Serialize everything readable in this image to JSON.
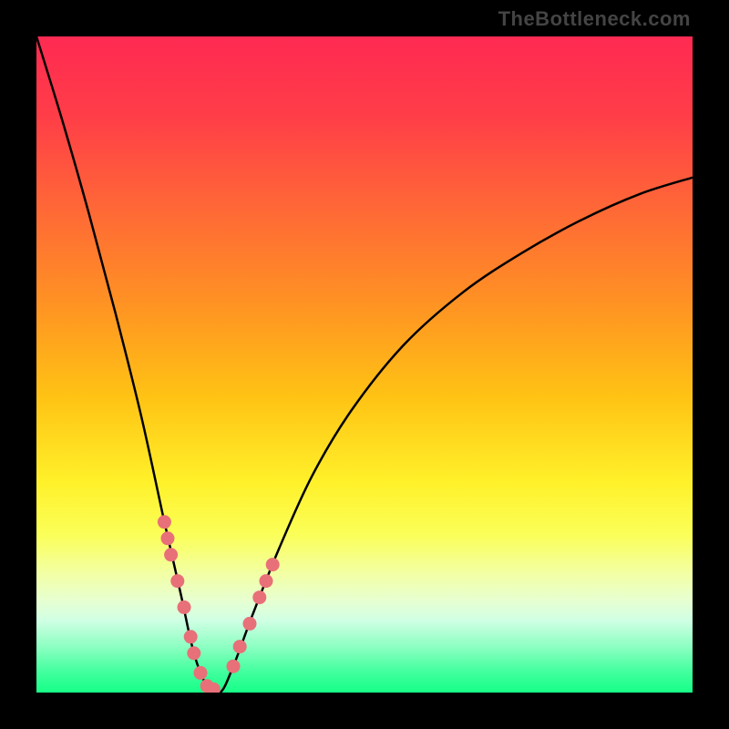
{
  "watermark": "TheBottleneck.com",
  "gradient_stops": [
    {
      "pct": 0,
      "color": "#ff2a52"
    },
    {
      "pct": 12,
      "color": "#ff3d48"
    },
    {
      "pct": 25,
      "color": "#ff6438"
    },
    {
      "pct": 40,
      "color": "#ff9024"
    },
    {
      "pct": 55,
      "color": "#ffc314"
    },
    {
      "pct": 68,
      "color": "#fff12a"
    },
    {
      "pct": 76,
      "color": "#fbff59"
    },
    {
      "pct": 82,
      "color": "#f2ffa6"
    },
    {
      "pct": 86,
      "color": "#e7ffd1"
    },
    {
      "pct": 89,
      "color": "#d0ffe4"
    },
    {
      "pct": 93,
      "color": "#8cffc2"
    },
    {
      "pct": 97,
      "color": "#3fff9d"
    },
    {
      "pct": 100,
      "color": "#17ff88"
    }
  ],
  "chart_data": {
    "type": "line",
    "title": "",
    "xlabel": "",
    "ylabel": "",
    "x_unit": "fraction of width (0=left,1=right)",
    "y_unit": "bottleneck % (0=perfect match at bottom, 100=top)",
    "xlim": [
      0,
      1
    ],
    "ylim": [
      0,
      100
    ],
    "series": [
      {
        "name": "bottleneck-curve",
        "x": [
          0.0,
          0.04,
          0.08,
          0.12,
          0.16,
          0.195,
          0.22,
          0.24,
          0.26,
          0.28,
          0.3,
          0.33,
          0.37,
          0.42,
          0.48,
          0.56,
          0.65,
          0.74,
          0.83,
          0.92,
          1.0
        ],
        "y": [
          100.0,
          87.0,
          73.0,
          58.0,
          42.0,
          26.0,
          15.0,
          6.0,
          1.0,
          0.0,
          4.0,
          12.0,
          22.0,
          33.0,
          43.0,
          53.0,
          61.0,
          67.0,
          72.0,
          76.0,
          78.5
        ]
      },
      {
        "name": "highlighted-points-left",
        "x": [
          0.195,
          0.2,
          0.205,
          0.215,
          0.225,
          0.235,
          0.24,
          0.25,
          0.26,
          0.27
        ],
        "y": [
          26.0,
          23.5,
          21.0,
          17.0,
          13.0,
          8.5,
          6.0,
          3.0,
          1.0,
          0.5
        ]
      },
      {
        "name": "highlighted-points-right",
        "x": [
          0.3,
          0.31,
          0.325,
          0.34,
          0.35,
          0.36
        ],
        "y": [
          4.0,
          7.0,
          10.5,
          14.5,
          17.0,
          19.5
        ]
      }
    ],
    "point_color": "#e87078",
    "curve_color": "#000000"
  }
}
